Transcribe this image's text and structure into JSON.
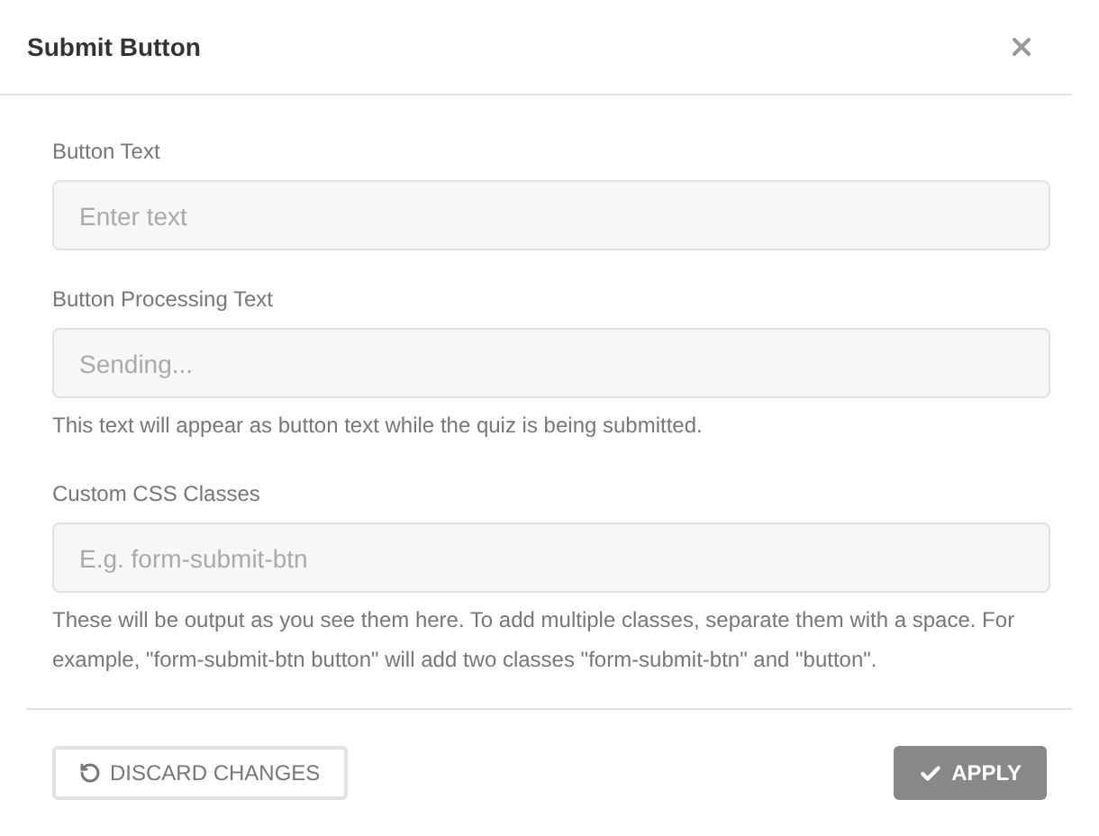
{
  "dialog": {
    "title": "Submit Button"
  },
  "fields": [
    {
      "label": "Button Text",
      "placeholder": "Enter text"
    },
    {
      "label": "Button Processing Text",
      "placeholder": "Sending...",
      "help": "This text will appear as button text while the quiz is being submitted."
    },
    {
      "label": "Custom CSS Classes",
      "placeholder": "E.g. form-submit-btn",
      "help": "These will be output as you see them here. To add multiple classes, separate them with a space. For example, \"form-submit-btn button\" will add two classes \"form-submit-btn\" and \"button\"."
    }
  ],
  "footer": {
    "discard": "DISCARD CHANGES",
    "apply": "APPLY"
  }
}
